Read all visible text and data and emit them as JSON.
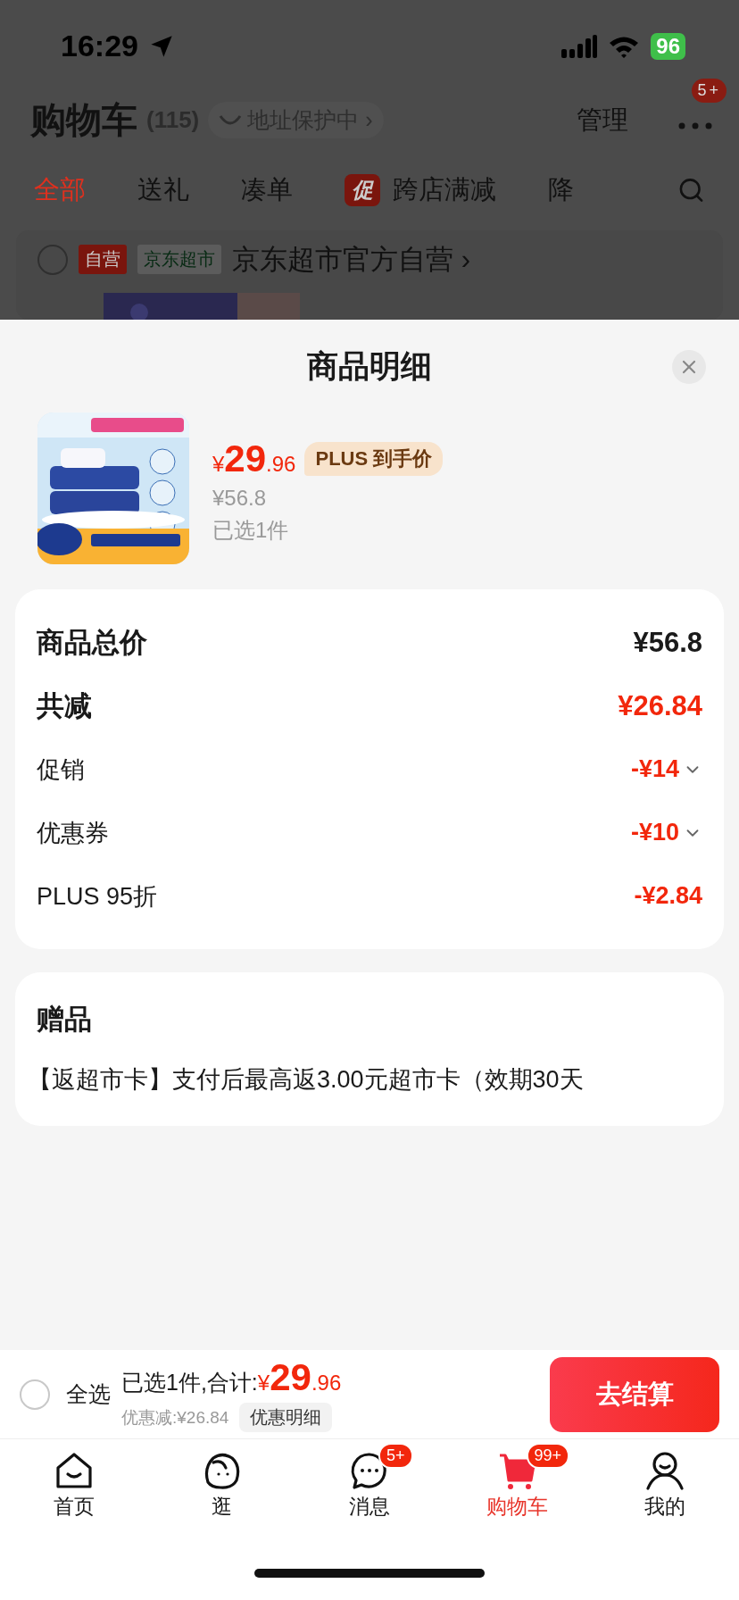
{
  "status_bar": {
    "time": "16:29",
    "battery": "96"
  },
  "header": {
    "title": "购物车",
    "count": "(115)",
    "address": "地址保护中",
    "address_arrow": "›",
    "manage": "管理",
    "more_badge": "5+"
  },
  "filter_tabs": [
    {
      "label": "全部",
      "selected": true
    },
    {
      "label": "送礼",
      "selected": false
    },
    {
      "label": "凑单",
      "selected": false
    },
    {
      "label": "跨店满减",
      "selected": false,
      "tag": "促"
    },
    {
      "label": "降",
      "selected": false
    }
  ],
  "store": {
    "checked": false,
    "tags": [
      "自营",
      "京东超市"
    ],
    "name": "京东超市官方自营",
    "arrow": "›"
  },
  "sheet": {
    "title": "商品明细",
    "product": {
      "currency": "¥",
      "price_int": "29",
      "price_dec": ".96",
      "price_tag": "PLUS 到手价",
      "original_price": "¥56.8",
      "selected_count": "已选1件"
    },
    "summary": [
      {
        "kind": "total",
        "label": "商品总价",
        "value": "¥56.8",
        "expandable": false
      },
      {
        "kind": "reduction",
        "label": "共减",
        "value": "¥26.84",
        "expandable": false
      },
      {
        "kind": "discount",
        "label": "促销",
        "value": "-¥14",
        "expandable": true
      },
      {
        "kind": "discount",
        "label": "优惠券",
        "value": "-¥10",
        "expandable": true
      },
      {
        "kind": "discount",
        "label": "PLUS 95折",
        "value": "-¥2.84",
        "expandable": false
      }
    ],
    "gift": {
      "title": "赠品",
      "text": "【返超市卡】支付后最高返3.00元超市卡（效期30天"
    }
  },
  "bottom_bar": {
    "select_all": {
      "label": "全选",
      "checked": false
    },
    "summary": "已选1件,合计:",
    "currency": "¥",
    "total_int": "29",
    "total_dec": ".96",
    "saving": "优惠减:¥26.84",
    "detail_button": "优惠明细",
    "checkout": "去结算"
  },
  "nav": [
    {
      "kind": "home",
      "label": "首页",
      "selected": false
    },
    {
      "kind": "explore",
      "label": "逛",
      "selected": false
    },
    {
      "kind": "message",
      "label": "消息",
      "selected": false,
      "badge": "5+"
    },
    {
      "kind": "cart",
      "label": "购物车",
      "selected": true,
      "badge": "99+"
    },
    {
      "kind": "profile",
      "label": "我的",
      "selected": false
    }
  ]
}
